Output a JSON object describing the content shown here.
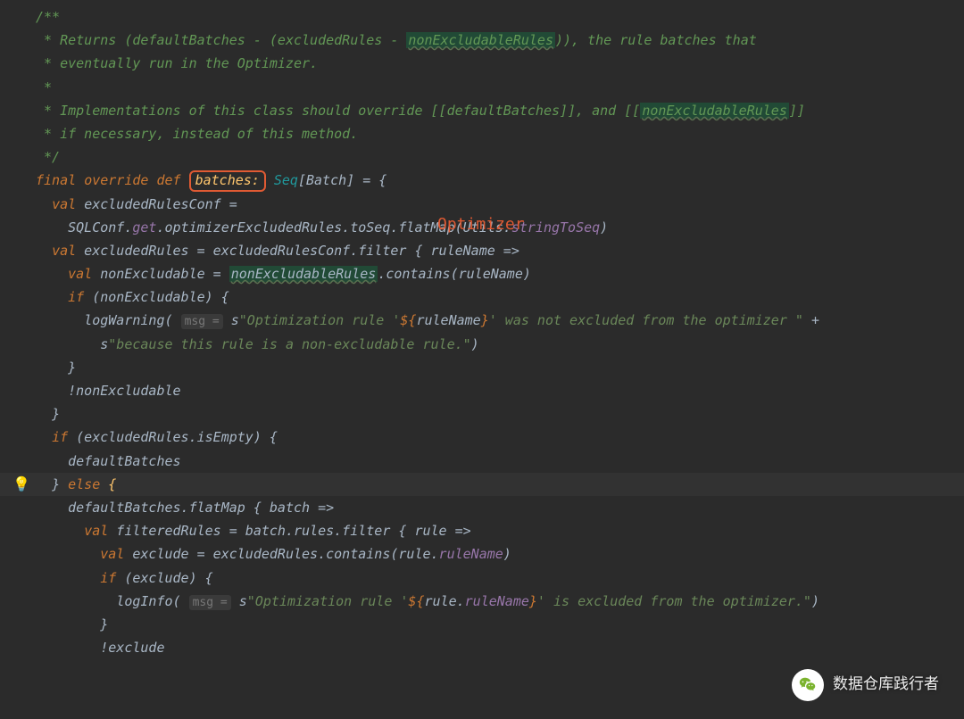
{
  "annotation_label": "Optimizer",
  "intention_bulb": "💡",
  "comment": {
    "l1": "/**",
    "l2_a": " * Returns (defaultBatches - (excludedRules - ",
    "l2_hl": "nonExcludableRules",
    "l2_b": ")), the rule batches that",
    "l3": " * eventually run in the Optimizer.",
    "l4": " *",
    "l5_a": " * Implementations of this class should override [[defaultBatches]], and [[",
    "l5_hl": "nonExcludableRules",
    "l5_b": "]]",
    "l6": " * if necessary, instead of this method.",
    "l7": " */"
  },
  "sig": {
    "kw_final": "final",
    "kw_override": "override",
    "kw_def": "def",
    "name": "batches:",
    "type_seq": "Seq",
    "lbr": "[",
    "type_batch": "Batch",
    "rbr_eq": "] = {"
  },
  "b1": {
    "kw_val": "val",
    "name": "excludedRulesConf",
    "eq": " ="
  },
  "b2": {
    "a": "SQLConf.",
    "get": "get",
    "b": ".optimizerExcludedRules.toSeq.flatMap(Utils.",
    "fn": "stringToSeq",
    "c": ")"
  },
  "b3": {
    "kw_val": "val",
    "name": " excludedRules = excludedRulesConf.filter { ruleName =>"
  },
  "b4": {
    "kw_val": "val",
    "a": " nonExcludable = ",
    "hl": "nonExcludableRules",
    "b": ".contains(ruleName)"
  },
  "b5": {
    "kw_if": "if",
    "cond": " (nonExcludable) {"
  },
  "b6": {
    "fn": "logWarning( ",
    "hint": "msg =",
    "s": " s",
    "str_a": "\"Optimization rule '",
    "int1": "${",
    "int1v": "ruleName",
    "int1e": "}",
    "str_b": "' was not excluded from the optimizer \"",
    "plus": " +"
  },
  "b7": {
    "s": "s",
    "str": "\"because this rule is a non-excludable rule.\"",
    "close": ")"
  },
  "b8": "}",
  "b9": "!nonExcludable",
  "b10": "}",
  "b11": {
    "kw_if": "if",
    "cond": " (excludedRules.isEmpty) {"
  },
  "b12": "defaultBatches",
  "b13": {
    "close": "} ",
    "kw_else": "else",
    "open": " {"
  },
  "b14": "defaultBatches.flatMap { batch =>",
  "b15": {
    "kw_val": "val",
    "rest": " filteredRules = batch.rules.filter { rule =>"
  },
  "b16": {
    "kw_val": "val",
    "a": " exclude = excludedRules.contains(rule.",
    "prop": "ruleName",
    "b": ")"
  },
  "b17": {
    "kw_if": "if",
    "cond": " (exclude) {"
  },
  "b18": {
    "fn": "logInfo( ",
    "hint": "msg =",
    "s": " s",
    "str_a": "\"Optimization rule '",
    "int1": "${",
    "int1a": "rule.",
    "int1p": "ruleName",
    "int1e": "}",
    "str_b": "' is excluded from the optimizer.\"",
    "close": ")"
  },
  "b19": "}",
  "b20": "!exclude",
  "watermark": {
    "icon": "✦",
    "text": "数据仓库践行者"
  }
}
